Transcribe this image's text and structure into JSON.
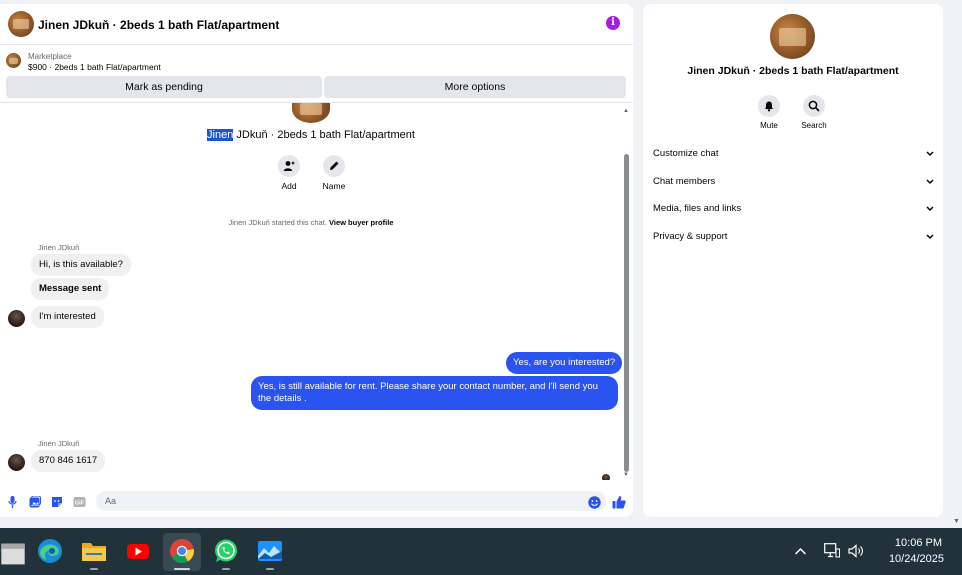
{
  "header": {
    "title": "Jinen JDkuň · 2beds 1 bath Flat/apartment"
  },
  "listing": {
    "label": "Marketplace",
    "price_title": "$900 · 2beds 1 bath Flat/apartment",
    "mark_pending": "Mark as pending",
    "more_options": "More options"
  },
  "thread": {
    "title_highlight": "Jinen",
    "title_rest": " JDkuň · 2beds 1 bath Flat/apartment",
    "add_label": "Add",
    "name_label": "Name",
    "started_text": "Jinen JDkuň started this chat.",
    "buyer_profile_link": "View buyer profile"
  },
  "messages": {
    "sender_name_1": "Jinen JDkuň",
    "in_1": "Hi, is this available?",
    "in_2": "Message sent",
    "in_3": "I'm interested",
    "out_1": "Yes, are you interested?",
    "out_2": "Yes, is still available for rent. Please share your contact number, and I'll send you the details .",
    "sender_name_2": "Jinen JDkuň",
    "in_4": "870 846 1617"
  },
  "composer": {
    "placeholder": "Aa"
  },
  "side": {
    "title": "Jinen JDkuň · 2beds 1 bath Flat/apartment",
    "mute_label": "Mute",
    "search_label": "Search",
    "items": [
      {
        "label": "Customize chat"
      },
      {
        "label": "Chat members"
      },
      {
        "label": "Media, files and links"
      },
      {
        "label": "Privacy & support"
      }
    ]
  },
  "taskbar": {
    "time": "10:06 PM",
    "date": "10/24/2025"
  },
  "colors": {
    "accent": "#2a53ef",
    "info": "#a51ce3",
    "taskbar": "#21323a"
  }
}
